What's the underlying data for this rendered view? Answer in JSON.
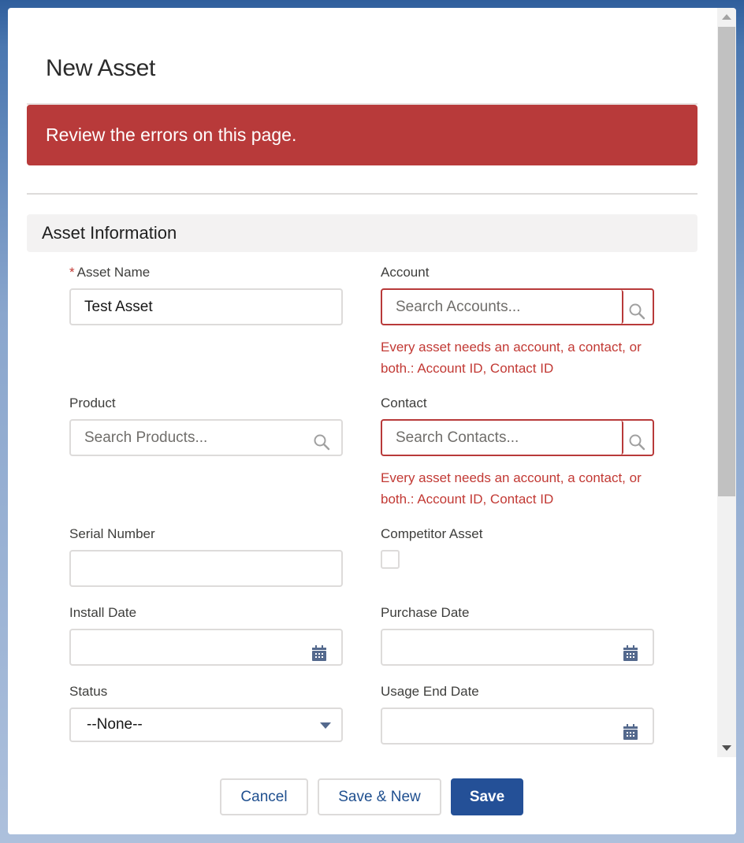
{
  "modal": {
    "title": "New Asset",
    "error_banner": "Review the errors on this page.",
    "section_title": "Asset Information"
  },
  "fields": {
    "asset_name": {
      "label": "Asset Name",
      "required_marker": "*",
      "value": "Test Asset"
    },
    "account": {
      "label": "Account",
      "placeholder": "Search Accounts...",
      "error": "Every asset needs an account, a contact, or both.: Account ID, Contact ID"
    },
    "product": {
      "label": "Product",
      "placeholder": "Search Products..."
    },
    "contact": {
      "label": "Contact",
      "placeholder": "Search Contacts...",
      "error": "Every asset needs an account, a contact, or both.: Account ID, Contact ID"
    },
    "serial_number": {
      "label": "Serial Number",
      "value": ""
    },
    "competitor_asset": {
      "label": "Competitor Asset",
      "checked": false
    },
    "install_date": {
      "label": "Install Date",
      "value": ""
    },
    "purchase_date": {
      "label": "Purchase Date",
      "value": ""
    },
    "status": {
      "label": "Status",
      "selected": "--None--"
    },
    "usage_end_date": {
      "label": "Usage End Date",
      "value": ""
    }
  },
  "icons": {
    "search": "search-icon",
    "calendar": "calendar-icon",
    "dropdown": "chevron-down-icon"
  },
  "footer": {
    "cancel_label": "Cancel",
    "save_new_label": "Save & New",
    "save_label": "Save"
  },
  "colors": {
    "error": "#b83a3a",
    "brand": "#245097",
    "section_bg": "#f3f2f2"
  }
}
